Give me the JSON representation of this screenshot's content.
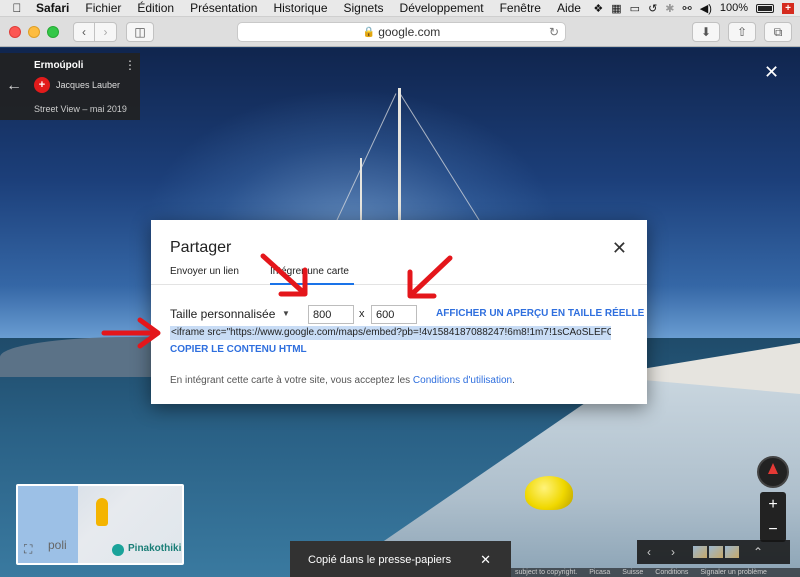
{
  "menubar": {
    "app": "Safari",
    "items": [
      "Fichier",
      "Édition",
      "Présentation",
      "Historique",
      "Signets",
      "Développement",
      "Fenêtre",
      "Aide"
    ],
    "battery": "100%"
  },
  "toolbar": {
    "url": "google.com"
  },
  "streetview": {
    "place": "Ermoúpoli",
    "author": "Jacques Lauber",
    "date": "Street View – mai 2019"
  },
  "dialog": {
    "title": "Partager",
    "tab_send_link": "Envoyer un lien",
    "tab_embed_map": "Intégrer une carte",
    "size_label": "Taille personnalisée",
    "width_value": "800",
    "height_value": "600",
    "times": "x",
    "preview_link": "AFFICHER UN APERÇU EN TAILLE RÉELLE",
    "iframe_code": "<iframe src=\"https://www.google.com/maps/embed?pb=!4v1584187088247!6m8!1m7!1sCAoSLEFC",
    "copy_html": "COPIER LE CONTENU HTML",
    "terms_text": "En intégrant cette carte à votre site, vous acceptez les ",
    "terms_link": "Conditions d'utilisation",
    "terms_end": "."
  },
  "minimap": {
    "place_label": "Pinakothiki",
    "partial_label": "poli"
  },
  "toast": {
    "message": "Copié dans le presse-papiers"
  },
  "footer": {
    "items": [
      "subject to copyright.",
      "Picasa",
      "Suisse",
      "Conditions",
      "Signaler un problème"
    ]
  },
  "colors": {
    "accent": "#2f6fde",
    "selection": "#c8dcf5",
    "arrow": "#e4161b"
  }
}
